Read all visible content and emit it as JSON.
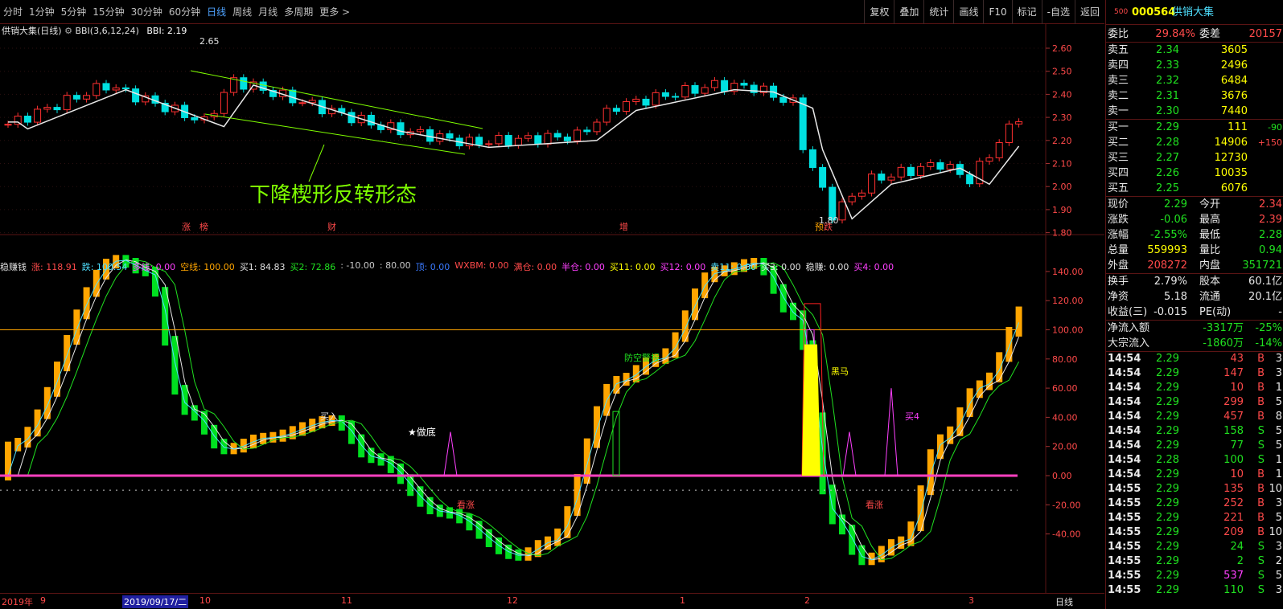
{
  "toolbar": {
    "periods": [
      "分时",
      "1分钟",
      "5分钟",
      "15分钟",
      "30分钟",
      "60分钟",
      "日线",
      "周线",
      "月线",
      "多周期",
      "更多 >"
    ],
    "active": "日线",
    "right_buttons": [
      "复权",
      "叠加",
      "统计",
      "画线",
      "F10",
      "标记",
      "-自选",
      "返回"
    ]
  },
  "price_header": {
    "title": "供销大集(日线)",
    "indicator": "BBI(3,6,12,24)",
    "value": "BBI: 2.19"
  },
  "price_axis": [
    "2.60",
    "2.50",
    "2.40",
    "2.30",
    "2.20",
    "2.10",
    "2.00",
    "1.90",
    "1.80"
  ],
  "annotations": {
    "high": "2.65",
    "low": "1.80",
    "pattern": "下降楔形反转形态"
  },
  "event_marks": [
    "涨",
    "榜",
    "财",
    "增",
    "预",
    "跌"
  ],
  "indicator_header": [
    {
      "t": "稳赚钱",
      "c": "#e0e0e0"
    },
    {
      "t": "涨: 118.91",
      "c": "#ff4a4a"
    },
    {
      "t": "跌: 100.54",
      "c": "#4fe0ff"
    },
    {
      "t": "多线: 0.00",
      "c": "#ff40ff"
    },
    {
      "t": "空线: 100.00",
      "c": "#ffa500"
    },
    {
      "t": "买1: 84.83",
      "c": "#e0e0e0"
    },
    {
      "t": "买2: 72.86",
      "c": "#20e020"
    },
    {
      "t": ": -10.00",
      "c": "#c8c8c8"
    },
    {
      "t": ": 80.00",
      "c": "#c8c8c8"
    },
    {
      "t": "顶: 0.00",
      "c": "#3a7aff"
    },
    {
      "t": "WXBM: 0.00",
      "c": "#ff4a4a"
    },
    {
      "t": "满仓: 0.00",
      "c": "#ff4a4a"
    },
    {
      "t": "半仓: 0.00",
      "c": "#ff40ff"
    },
    {
      "t": "买11: 0.00",
      "c": "#ffff00"
    },
    {
      "t": "买12: 0.00",
      "c": "#ff40ff"
    },
    {
      "t": "卖11: 0.00",
      "c": "#4fe0ff"
    },
    {
      "t": "买3: 0.00",
      "c": "#e0e0e0"
    },
    {
      "t": "稳赚: 0.00",
      "c": "#e0e0e0"
    },
    {
      "t": "买4: 0.00",
      "c": "#ff40ff"
    }
  ],
  "indicator_axis": [
    "140.00",
    "120.00",
    "100.00",
    "80.00",
    "60.00",
    "40.00",
    "20.00",
    "0.00",
    "-20.00",
    "-40.00"
  ],
  "indicator_labels": {
    "buy": "买入",
    "bottom": "★做底",
    "air_alert": "防空警报",
    "dark_horse": "黑马",
    "buy4": "买4",
    "rise1": "看涨",
    "rise2": "看涨"
  },
  "time_axis": [
    "2019年",
    "9",
    "2019/09/17/二",
    "10",
    "11",
    "12",
    "1",
    "2",
    "3"
  ],
  "bottom_right": "日线",
  "quote": {
    "code_prefix": "500",
    "code": "000564",
    "name": "供销大集",
    "weibi_label": "委比",
    "weibi": "29.84%",
    "weicha_label": "委差",
    "weicha": "20157",
    "asks": [
      {
        "label": "卖五",
        "price": "2.34",
        "vol": "3605"
      },
      {
        "label": "卖四",
        "price": "2.33",
        "vol": "2496"
      },
      {
        "label": "卖三",
        "price": "2.32",
        "vol": "6484"
      },
      {
        "label": "卖二",
        "price": "2.31",
        "vol": "3676"
      },
      {
        "label": "卖一",
        "price": "2.30",
        "vol": "7440"
      }
    ],
    "bids": [
      {
        "label": "买一",
        "price": "2.29",
        "vol": "111",
        "chg": "-90"
      },
      {
        "label": "买二",
        "price": "2.28",
        "vol": "14906",
        "chg": "+150"
      },
      {
        "label": "买三",
        "price": "2.27",
        "vol": "12730",
        "chg": ""
      },
      {
        "label": "买四",
        "price": "2.26",
        "vol": "10035",
        "chg": ""
      },
      {
        "label": "买五",
        "price": "2.25",
        "vol": "6076",
        "chg": ""
      }
    ],
    "stats": [
      {
        "l1": "现价",
        "v1": "2.29",
        "c1": "green",
        "l2": "今开",
        "v2": "2.34",
        "c2": "red"
      },
      {
        "l1": "涨跌",
        "v1": "-0.06",
        "c1": "green",
        "l2": "最高",
        "v2": "2.39",
        "c2": "red"
      },
      {
        "l1": "涨幅",
        "v1": "-2.55%",
        "c1": "green",
        "l2": "最低",
        "v2": "2.28",
        "c2": "green"
      },
      {
        "l1": "总量",
        "v1": "559993",
        "c1": "yellow",
        "l2": "量比",
        "v2": "0.94",
        "c2": "green"
      },
      {
        "l1": "外盘",
        "v1": "208272",
        "c1": "red",
        "l2": "内盘",
        "v2": "351721",
        "c2": "green"
      }
    ],
    "stats2": [
      {
        "l1": "换手",
        "v1": "2.79%",
        "l2": "股本",
        "v2": "60.1亿"
      },
      {
        "l1": "净资",
        "v1": "5.18",
        "l2": "流通",
        "v2": "20.1亿"
      },
      {
        "l1": "收益(三)",
        "v1": "-0.015",
        "l2": "PE(动)",
        "v2": "-"
      }
    ],
    "flows": [
      {
        "l": "净流入额",
        "v": "-3317万",
        "p": "-25%"
      },
      {
        "l": "大宗流入",
        "v": "-1860万",
        "p": "-14%"
      }
    ],
    "ticks": [
      {
        "t": "14:54",
        "p": "2.29",
        "v": "43",
        "s": "B",
        "n": "3"
      },
      {
        "t": "14:54",
        "p": "2.29",
        "v": "147",
        "s": "B",
        "n": "3"
      },
      {
        "t": "14:54",
        "p": "2.29",
        "v": "10",
        "s": "B",
        "n": "1"
      },
      {
        "t": "14:54",
        "p": "2.29",
        "v": "299",
        "s": "B",
        "n": "5"
      },
      {
        "t": "14:54",
        "p": "2.29",
        "v": "457",
        "s": "B",
        "n": "8"
      },
      {
        "t": "14:54",
        "p": "2.29",
        "v": "158",
        "s": "S",
        "n": "5"
      },
      {
        "t": "14:54",
        "p": "2.29",
        "v": "77",
        "s": "S",
        "n": "5"
      },
      {
        "t": "14:54",
        "p": "2.28",
        "v": "100",
        "s": "S",
        "n": "1"
      },
      {
        "t": "14:54",
        "p": "2.29",
        "v": "10",
        "s": "B",
        "n": "1"
      },
      {
        "t": "14:55",
        "p": "2.29",
        "v": "135",
        "s": "B",
        "n": "10"
      },
      {
        "t": "14:55",
        "p": "2.29",
        "v": "252",
        "s": "B",
        "n": "3"
      },
      {
        "t": "14:55",
        "p": "2.29",
        "v": "221",
        "s": "B",
        "n": "5"
      },
      {
        "t": "14:55",
        "p": "2.29",
        "v": "209",
        "s": "B",
        "n": "10"
      },
      {
        "t": "14:55",
        "p": "2.29",
        "v": "24",
        "s": "S",
        "n": "3"
      },
      {
        "t": "14:55",
        "p": "2.29",
        "v": "2",
        "s": "S",
        "n": "2"
      },
      {
        "t": "14:55",
        "p": "2.29",
        "v": "537",
        "s": "S",
        "n": "5"
      },
      {
        "t": "14:55",
        "p": "2.29",
        "v": "110",
        "s": "S",
        "n": "3"
      }
    ]
  }
}
